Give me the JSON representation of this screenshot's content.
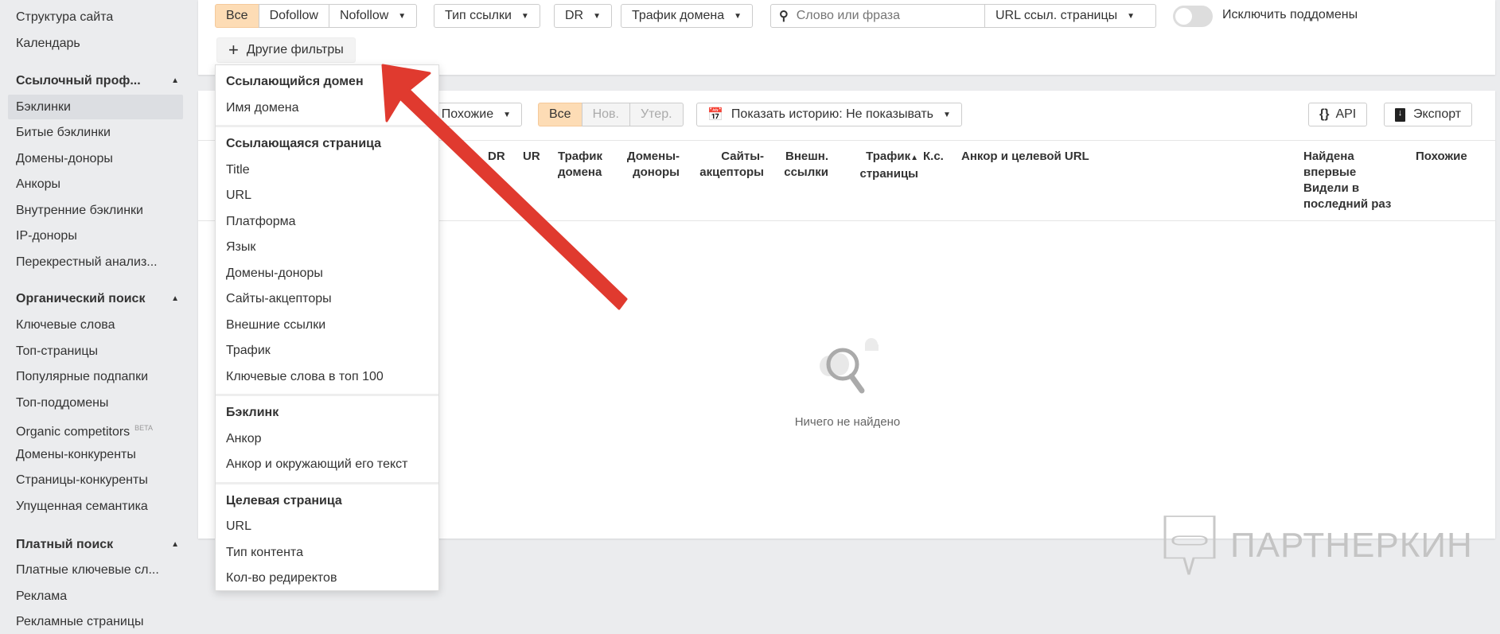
{
  "sidebar": {
    "top_items": [
      "Структура сайта",
      "Календарь"
    ],
    "sections": [
      {
        "title": "Ссылочный проф...",
        "items": [
          "Бэклинки",
          "Битые бэклинки",
          "Домены-доноры",
          "Анкоры",
          "Внутренние бэклинки",
          "IP-доноры",
          "Перекрестный анализ..."
        ],
        "active": "Бэклинки"
      },
      {
        "title": "Органический поиск",
        "items": [
          "Ключевые слова",
          "Топ-страницы",
          "Популярные подпапки",
          "Топ-поддомены",
          "Organic competitors",
          "Домены-конкуренты",
          "Страницы-конкуренты",
          "Упущенная семантика"
        ],
        "beta_label": "BETA"
      },
      {
        "title": "Платный поиск",
        "items": [
          "Платные ключевые сл...",
          "Реклама",
          "Рекламные страницы"
        ]
      }
    ]
  },
  "filters": {
    "link_type_group": [
      "Все",
      "Dofollow",
      "Nofollow"
    ],
    "link_type": "Тип ссылки",
    "dr": "DR",
    "domain_traffic": "Трафик домена",
    "search_placeholder": "Слово или фраза",
    "search_scope": "URL ссыл. страницы",
    "exclude_subdomains": "Исключить поддомены",
    "exclude_subdomains_on": false,
    "more_filters": "Другие фильтры"
  },
  "toolbar": {
    "similar": "Похожие",
    "period": [
      "Все",
      "Нов.",
      "Утер."
    ],
    "history": "Показать историю: Не показывать",
    "api": "API",
    "export": "Экспорт"
  },
  "table": {
    "headers": {
      "dr": "DR",
      "ur": "UR",
      "domain_traffic": [
        "Трафик",
        "домена"
      ],
      "ref_domains": [
        "Домены-",
        "доноры"
      ],
      "acceptors": [
        "Сайты-",
        "акцепторы"
      ],
      "ext_links": [
        "Внешн.",
        "ссылки"
      ],
      "page_traffic": [
        "Трафик",
        "страницы"
      ],
      "ks": "К.с.",
      "anchor": "Анкор и целевой URL",
      "found": [
        "Найдена",
        "впервые",
        "Видели в",
        "последний раз"
      ],
      "similar": "Похожие"
    },
    "empty": "Ничего не найдено"
  },
  "menu": [
    {
      "header": "Ссылающийся домен",
      "items": [
        "Имя домена"
      ]
    },
    {
      "header": "Ссылающаяся страница",
      "items": [
        "Title",
        "URL",
        "Платформа",
        "Язык",
        "Домены-доноры",
        "Сайты-акцепторы",
        "Внешние ссылки",
        "Трафик",
        "Ключевые слова в топ 100"
      ]
    },
    {
      "header": "Бэклинк",
      "items": [
        "Анкор",
        "Анкор и окружающий его текст"
      ]
    },
    {
      "header": "Целевая страница",
      "items": [
        "URL",
        "Тип контента",
        "Кол-во редиректов"
      ]
    }
  ],
  "watermark": "ПАРТНЕРКИН",
  "colors": {
    "active_segment": "#fddcb5",
    "arrow": "#e03a2f"
  }
}
